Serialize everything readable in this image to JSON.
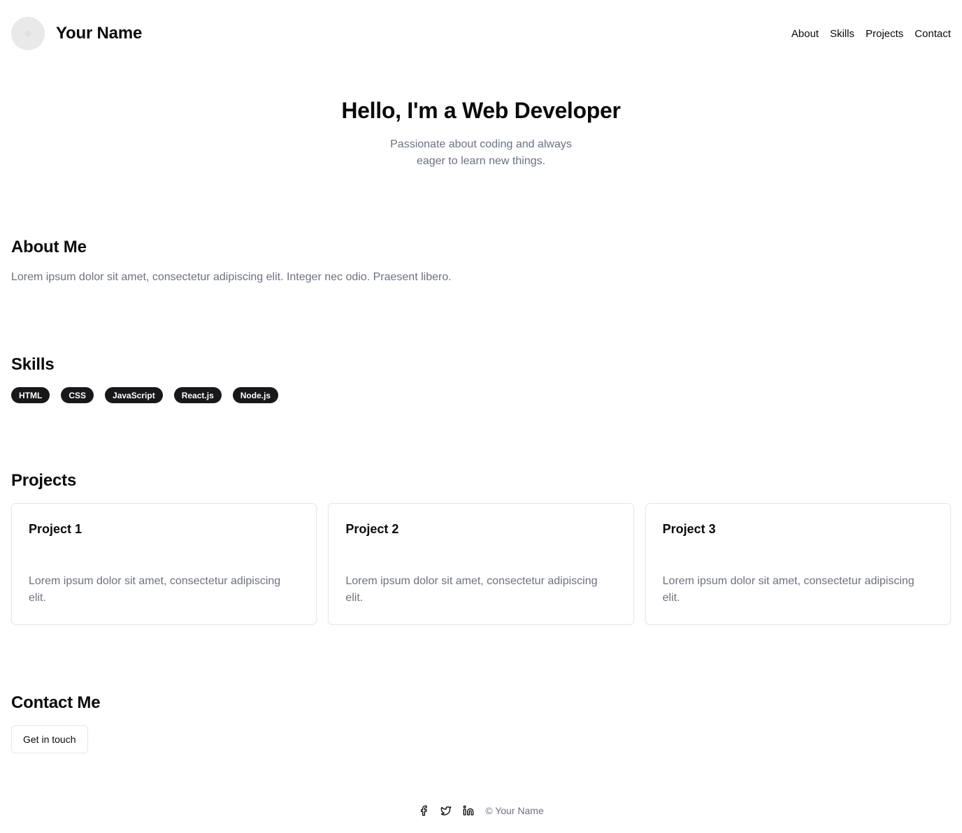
{
  "header": {
    "brand_name": "Your Name",
    "nav": [
      {
        "label": "About"
      },
      {
        "label": "Skills"
      },
      {
        "label": "Projects"
      },
      {
        "label": "Contact"
      }
    ]
  },
  "hero": {
    "title": "Hello, I'm a Web Developer",
    "subtitle": "Passionate about coding and always eager to learn new things."
  },
  "about": {
    "heading": "About Me",
    "text": "Lorem ipsum dolor sit amet, consectetur adipiscing elit. Integer nec odio. Praesent libero."
  },
  "skills": {
    "heading": "Skills",
    "items": [
      "HTML",
      "CSS",
      "JavaScript",
      "React.js",
      "Node.js"
    ]
  },
  "projects": {
    "heading": "Projects",
    "items": [
      {
        "title": "Project 1",
        "description": "Lorem ipsum dolor sit amet, consectetur adipiscing elit."
      },
      {
        "title": "Project 2",
        "description": "Lorem ipsum dolor sit amet, consectetur adipiscing elit."
      },
      {
        "title": "Project 3",
        "description": "Lorem ipsum dolor sit amet, consectetur adipiscing elit."
      }
    ]
  },
  "contact": {
    "heading": "Contact Me",
    "button_label": "Get in touch"
  },
  "footer": {
    "icons": [
      "facebook-icon",
      "twitter-icon",
      "linkedin-icon"
    ],
    "copyright": "© Your Name"
  },
  "colors": {
    "text": "#0a0a0a",
    "muted": "#6b7280",
    "chip_bg": "#18181b",
    "border": "#e5e7eb"
  }
}
